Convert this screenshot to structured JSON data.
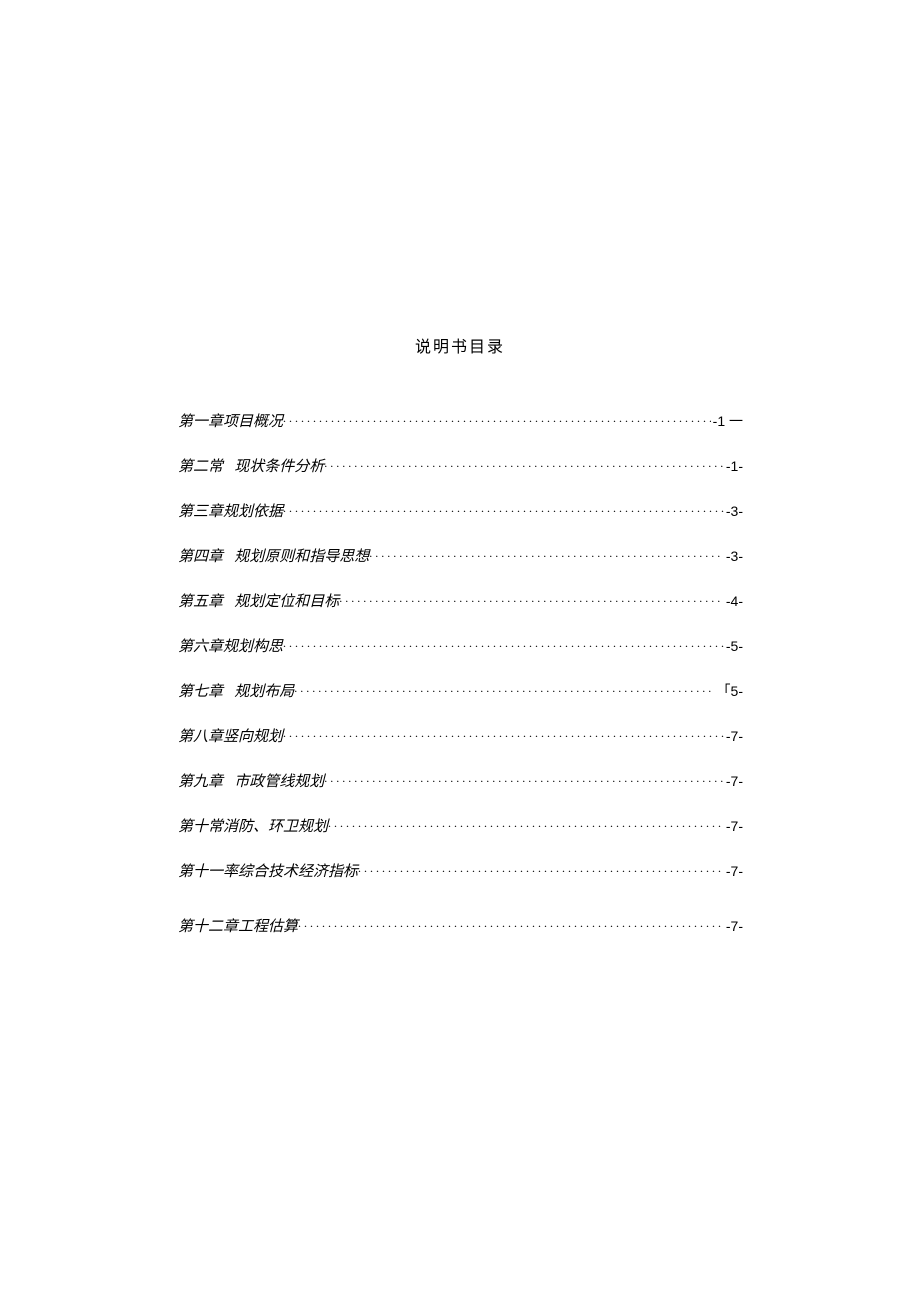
{
  "title": "说明书目录",
  "entries": [
    {
      "chapter": "第一章",
      "gap": "",
      "name": "项目概况",
      "page": "-1 一"
    },
    {
      "chapter": "第二常",
      "gap": "   ",
      "name": "现状条件分析",
      "page": "-1-"
    },
    {
      "chapter": "第三章",
      "gap": "",
      "name": "规划依据",
      "page": "-3-"
    },
    {
      "chapter": "第四章",
      "gap": "   ",
      "name": "规划原则和指导思想",
      "page": "-3-"
    },
    {
      "chapter": "第五章",
      "gap": "   ",
      "name": "规划定位和目标",
      "page": "-4-"
    },
    {
      "chapter": "第六章",
      "gap": "",
      "name": "规划构思",
      "page": "-5-"
    },
    {
      "chapter": "第七章",
      "gap": "   ",
      "name": "规划布局",
      "page": "「5-"
    },
    {
      "chapter": "第八章",
      "gap": "",
      "name": "竖向规划",
      "page": "-7-"
    },
    {
      "chapter": "第九章",
      "gap": "   ",
      "name": "市政管线规划",
      "page": "-7-"
    },
    {
      "chapter": "第十常",
      "gap": "",
      "name": "消防、环卫规划",
      "page": "-7-"
    },
    {
      "chapter": "第十一率",
      "gap": "",
      "name": "综合技术经济指标",
      "page": "-7-"
    },
    {
      "chapter": "第十二章",
      "gap": "",
      "name": "工程估算",
      "page": "-7-"
    }
  ]
}
